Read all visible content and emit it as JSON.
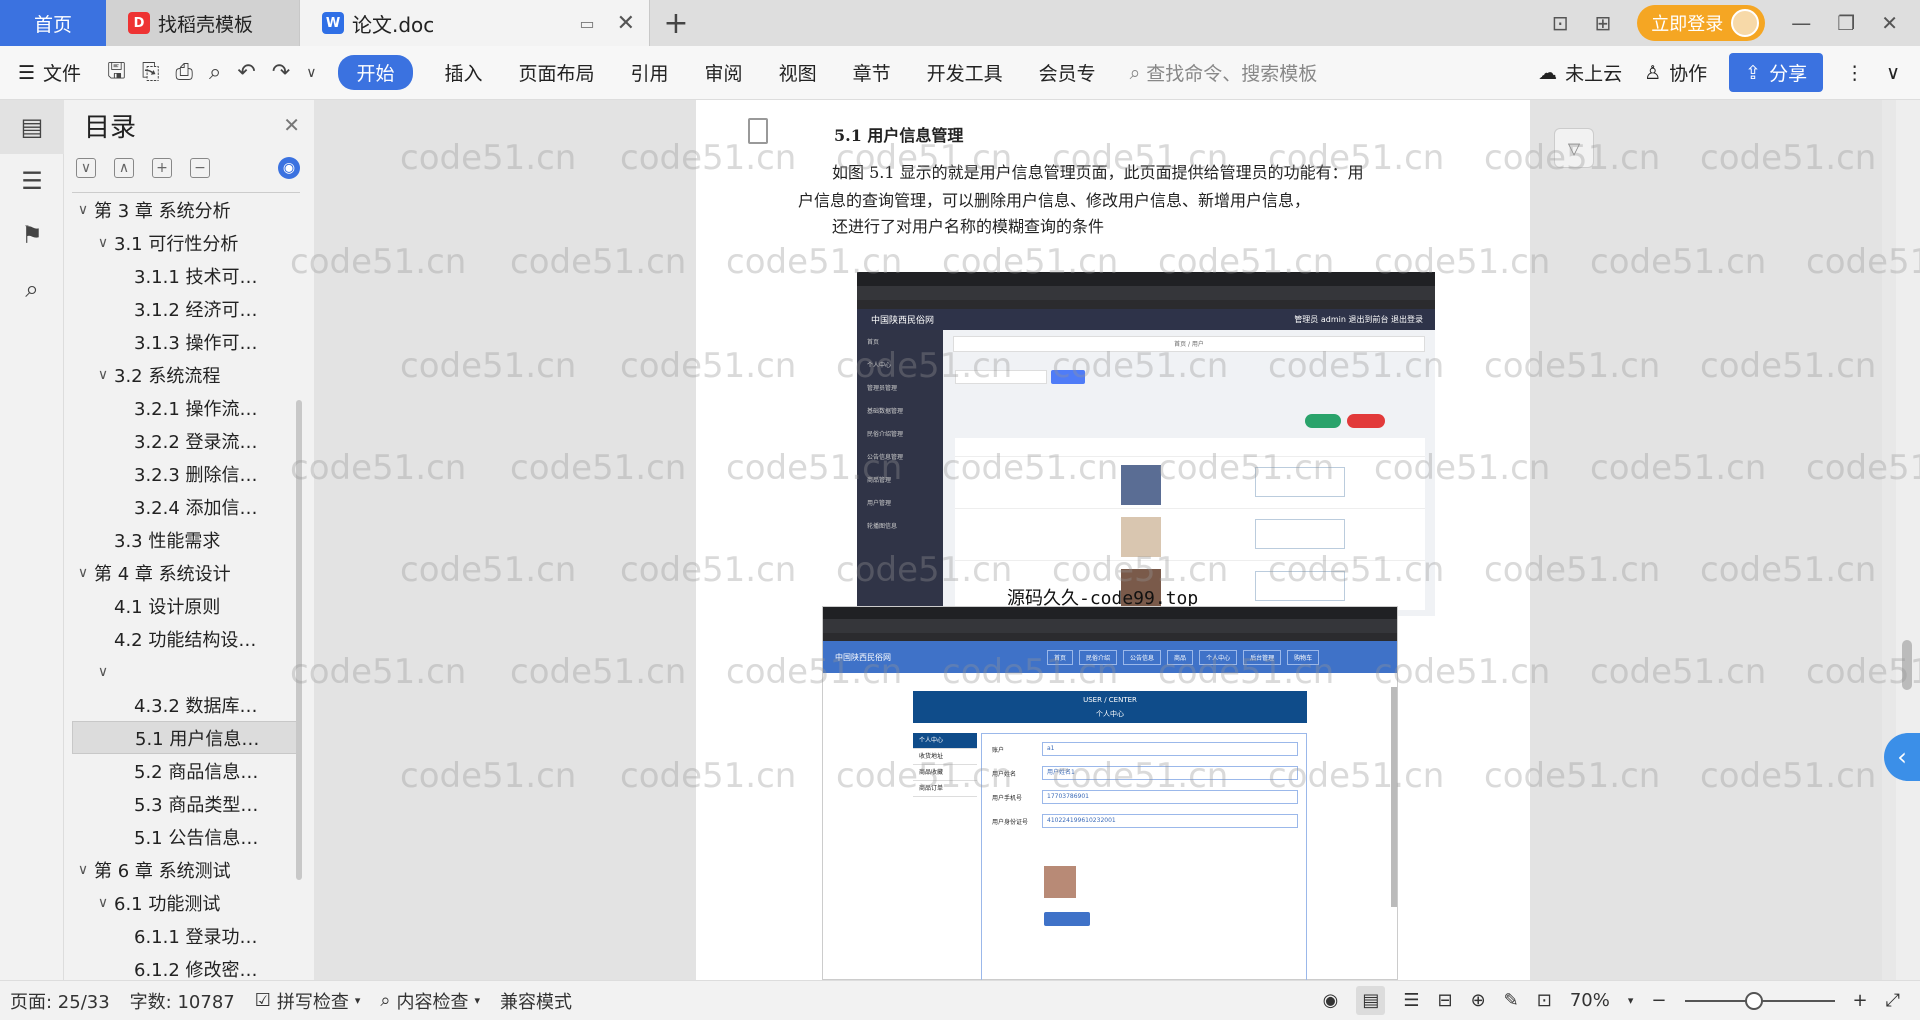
{
  "tabs": {
    "home": "首页",
    "tab1": "找稻壳模板",
    "tab2": "论文.doc",
    "add": "+"
  },
  "titlebar": {
    "login": "立即登录"
  },
  "ribbon": {
    "file": "文件",
    "start": "开始",
    "items": [
      "插入",
      "页面布局",
      "引用",
      "审阅",
      "视图",
      "章节",
      "开发工具",
      "会员专"
    ],
    "search_placeholder": "查找命令、搜索模板",
    "cloud": "未上云",
    "collab": "协作",
    "share": "分享"
  },
  "toc": {
    "title": "目录",
    "rows": [
      {
        "text": "第 3 章  系统分析",
        "level": 0,
        "caret": "∨"
      },
      {
        "text": "3.1  可行性分析",
        "level": 1,
        "caret": "∨"
      },
      {
        "text": "3.1.1  技术可…",
        "level": 2,
        "caret": ""
      },
      {
        "text": "3.1.2  经济可…",
        "level": 2,
        "caret": ""
      },
      {
        "text": "3.1.3  操作可…",
        "level": 2,
        "caret": ""
      },
      {
        "text": "3.2  系统流程",
        "level": 1,
        "caret": "∨"
      },
      {
        "text": "3.2.1  操作流…",
        "level": 2,
        "caret": ""
      },
      {
        "text": "3.2.2  登录流…",
        "level": 2,
        "caret": ""
      },
      {
        "text": "3.2.3  删除信…",
        "level": 2,
        "caret": ""
      },
      {
        "text": "3.2.4  添加信…",
        "level": 2,
        "caret": ""
      },
      {
        "text": "3.3  性能需求",
        "level": 1,
        "caret": ""
      },
      {
        "text": "第 4 章  系统设计",
        "level": 0,
        "caret": "∨"
      },
      {
        "text": "4.1  设计原则",
        "level": 1,
        "caret": ""
      },
      {
        "text": "4.2  功能结构设…",
        "level": 1,
        "caret": ""
      },
      {
        "text": "",
        "level": 1,
        "caret": "∨"
      },
      {
        "text": "4.3.2  数据库…",
        "level": 2,
        "caret": ""
      },
      {
        "text": "5.1 用户信息…",
        "level": 2,
        "caret": "",
        "selected": true
      },
      {
        "text": "5.2  商品信息…",
        "level": 2,
        "caret": ""
      },
      {
        "text": "5.3 商品类型…",
        "level": 2,
        "caret": ""
      },
      {
        "text": "5.1 公告信息…",
        "level": 2,
        "caret": ""
      },
      {
        "text": "第 6 章  系统测试",
        "level": 0,
        "caret": "∨"
      },
      {
        "text": "6.1  功能测试",
        "level": 1,
        "caret": "∨"
      },
      {
        "text": "6.1.1  登录功…",
        "level": 2,
        "caret": ""
      },
      {
        "text": "6.1.2  修改密…",
        "level": 2,
        "caret": ""
      }
    ]
  },
  "doc": {
    "heading": "5.1 用户信息管理",
    "line1": "如图 5.1 显示的就是用户信息管理页面，此页面提供给管理员的功能有：用",
    "line2": "户信息的查询管理，可以删除用户信息、修改用户信息、新增用户信息，",
    "line3": "还进行了对用户名称的模糊查询的条件",
    "overlay": "源码久久-code99.top"
  },
  "shot1": {
    "site": "中国陕西民俗网",
    "user": "管理员 admin   退出到前台   退出登录",
    "crumb": "首页 / 用户",
    "menu": [
      "首页",
      "个人中心",
      "管理员管理",
      "基础数据管理",
      "民俗介绍管理",
      "公告信息管理",
      "商品管理",
      "用户管理",
      "轮播图信息"
    ]
  },
  "shot2": {
    "site": "中国陕西民俗网",
    "nav": [
      "首页",
      "民俗介绍",
      "公告信息",
      "商品",
      "个人中心",
      "后台管理",
      "购物车"
    ],
    "title_en": "USER / CENTER",
    "title_cn": "个人中心",
    "menu": [
      "个人中心",
      "收货地址",
      "商品收藏",
      "商品订单"
    ],
    "fields": [
      {
        "label": "账户",
        "value": "a1"
      },
      {
        "label": "用户姓名",
        "value": "用户姓名1"
      },
      {
        "label": "用户手机号",
        "value": "17703786901"
      },
      {
        "label": "用户身份证号",
        "value": "410224199610232001"
      }
    ]
  },
  "status": {
    "page": "页面: 25/33",
    "words": "字数: 10787",
    "spell": "拼写检查",
    "content": "内容检查",
    "compat": "兼容模式",
    "zoom": "70%"
  },
  "watermark_text": "code51.cn",
  "colors": {
    "accent": "#3b72e0",
    "login": "#f5a623"
  }
}
